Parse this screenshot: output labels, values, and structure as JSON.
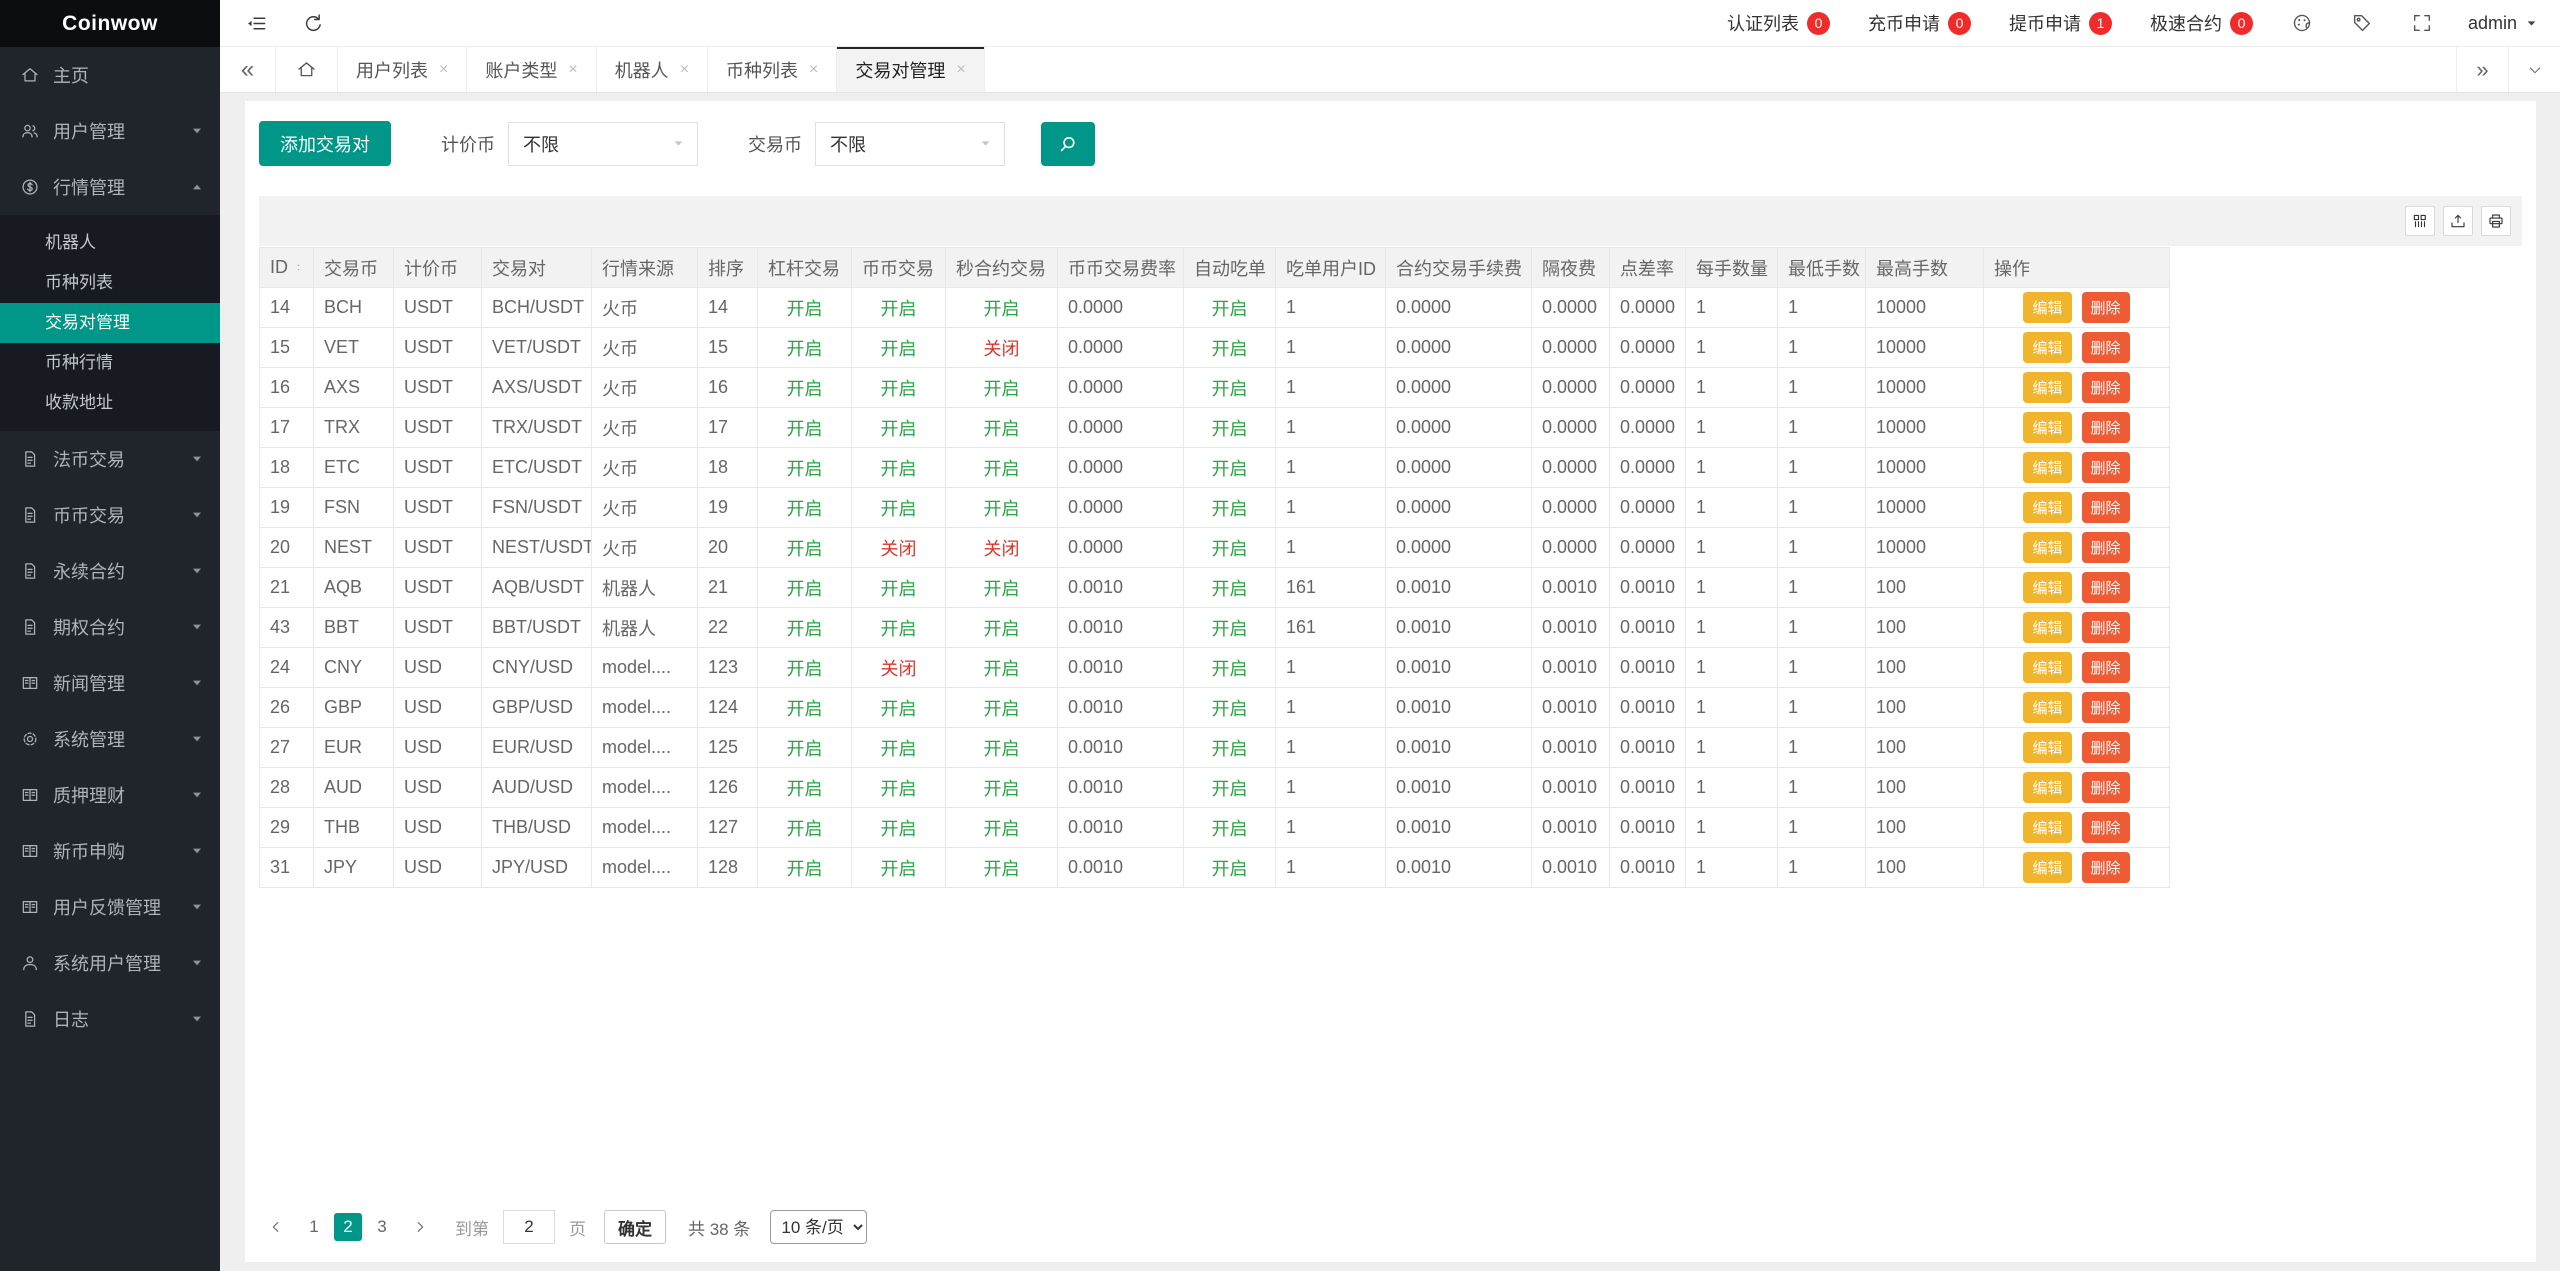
{
  "app": {
    "logo": "Coinwow"
  },
  "sidebar": {
    "items": [
      {
        "name": "home",
        "label": "主页",
        "icon": "home"
      },
      {
        "name": "user-management",
        "label": "用户管理",
        "icon": "users",
        "caret": "down"
      },
      {
        "name": "market-management",
        "label": "行情管理",
        "icon": "market",
        "caret": "up",
        "expanded": true,
        "children": [
          {
            "name": "robots",
            "label": "机器人"
          },
          {
            "name": "coin-list",
            "label": "币种列表"
          },
          {
            "name": "trading-pair-management",
            "label": "交易对管理",
            "active": true
          },
          {
            "name": "coin-market",
            "label": "币种行情"
          },
          {
            "name": "payment-address",
            "label": "收款地址"
          }
        ]
      },
      {
        "name": "fiat-trade",
        "label": "法币交易",
        "icon": "doc",
        "caret": "down"
      },
      {
        "name": "coin-trade",
        "label": "币币交易",
        "icon": "doc",
        "caret": "down"
      },
      {
        "name": "perpetual-contract",
        "label": "永续合约",
        "icon": "doc",
        "caret": "down"
      },
      {
        "name": "options-contract",
        "label": "期权合约",
        "icon": "doc",
        "caret": "down"
      },
      {
        "name": "news-management",
        "label": "新闻管理",
        "icon": "news",
        "caret": "down"
      },
      {
        "name": "system-management",
        "label": "系统管理",
        "icon": "gear",
        "caret": "down"
      },
      {
        "name": "staking-finance",
        "label": "质押理财",
        "icon": "news",
        "caret": "down"
      },
      {
        "name": "new-coin-subscription",
        "label": "新币申购",
        "icon": "news",
        "caret": "down"
      },
      {
        "name": "user-feedback-management",
        "label": "用户反馈管理",
        "icon": "news",
        "caret": "down"
      },
      {
        "name": "system-user-management",
        "label": "系统用户管理",
        "icon": "user",
        "caret": "down"
      },
      {
        "name": "logs",
        "label": "日志",
        "icon": "doc",
        "caret": "down"
      }
    ]
  },
  "topbar": {
    "nav": [
      {
        "name": "auth-list",
        "label": "认证列表",
        "badge": "0"
      },
      {
        "name": "deposit-requests",
        "label": "充币申请",
        "badge": "0"
      },
      {
        "name": "withdraw-requests",
        "label": "提币申请",
        "badge": "1"
      },
      {
        "name": "fast-contract",
        "label": "极速合约",
        "badge": "0"
      }
    ],
    "user": "admin"
  },
  "tabbar": {
    "tabs": [
      {
        "name": "user-list",
        "label": "用户列表"
      },
      {
        "name": "account-type",
        "label": "账户类型"
      },
      {
        "name": "robots",
        "label": "机器人"
      },
      {
        "name": "coin-list",
        "label": "币种列表"
      },
      {
        "name": "trading-pair-management",
        "label": "交易对管理",
        "active": true
      }
    ],
    "close_glyph": "×"
  },
  "filters": {
    "add_button": "添加交易对",
    "quote_label": "计价币",
    "quote_value": "不限",
    "base_label": "交易币",
    "base_value": "不限"
  },
  "table": {
    "columns": [
      "ID",
      "交易币",
      "计价币",
      "交易对",
      "行情来源",
      "排序",
      "杠杆交易",
      "币币交易",
      "秒合约交易",
      "币币交易费率",
      "自动吃单",
      "吃单用户ID",
      "合约交易手续费",
      "隔夜费",
      "点差率",
      "每手数量",
      "最低手数",
      "最高手数",
      "操作"
    ],
    "toggle_on": "开启",
    "toggle_off": "关闭",
    "actions": {
      "edit": "编辑",
      "delete": "删除"
    },
    "rows": [
      [
        "14",
        "BCH",
        "USDT",
        "BCH/USDT",
        "火币",
        "14",
        "开启",
        "开启",
        "开启",
        "0.0000",
        "开启",
        "1",
        "0.0000",
        "0.0000",
        "0.0000",
        "1",
        "1",
        "10000"
      ],
      [
        "15",
        "VET",
        "USDT",
        "VET/USDT",
        "火币",
        "15",
        "开启",
        "开启",
        "关闭",
        "0.0000",
        "开启",
        "1",
        "0.0000",
        "0.0000",
        "0.0000",
        "1",
        "1",
        "10000"
      ],
      [
        "16",
        "AXS",
        "USDT",
        "AXS/USDT",
        "火币",
        "16",
        "开启",
        "开启",
        "开启",
        "0.0000",
        "开启",
        "1",
        "0.0000",
        "0.0000",
        "0.0000",
        "1",
        "1",
        "10000"
      ],
      [
        "17",
        "TRX",
        "USDT",
        "TRX/USDT",
        "火币",
        "17",
        "开启",
        "开启",
        "开启",
        "0.0000",
        "开启",
        "1",
        "0.0000",
        "0.0000",
        "0.0000",
        "1",
        "1",
        "10000"
      ],
      [
        "18",
        "ETC",
        "USDT",
        "ETC/USDT",
        "火币",
        "18",
        "开启",
        "开启",
        "开启",
        "0.0000",
        "开启",
        "1",
        "0.0000",
        "0.0000",
        "0.0000",
        "1",
        "1",
        "10000"
      ],
      [
        "19",
        "FSN",
        "USDT",
        "FSN/USDT",
        "火币",
        "19",
        "开启",
        "开启",
        "开启",
        "0.0000",
        "开启",
        "1",
        "0.0000",
        "0.0000",
        "0.0000",
        "1",
        "1",
        "10000"
      ],
      [
        "20",
        "NEST",
        "USDT",
        "NEST/USDT",
        "火币",
        "20",
        "开启",
        "关闭",
        "关闭",
        "0.0000",
        "开启",
        "1",
        "0.0000",
        "0.0000",
        "0.0000",
        "1",
        "1",
        "10000"
      ],
      [
        "21",
        "AQB",
        "USDT",
        "AQB/USDT",
        "机器人",
        "21",
        "开启",
        "开启",
        "开启",
        "0.0010",
        "开启",
        "161",
        "0.0010",
        "0.0010",
        "0.0010",
        "1",
        "1",
        "100"
      ],
      [
        "43",
        "BBT",
        "USDT",
        "BBT/USDT",
        "机器人",
        "22",
        "开启",
        "开启",
        "开启",
        "0.0010",
        "开启",
        "161",
        "0.0010",
        "0.0010",
        "0.0010",
        "1",
        "1",
        "100"
      ],
      [
        "24",
        "CNY",
        "USD",
        "CNY/USD",
        "model....",
        "123",
        "开启",
        "关闭",
        "开启",
        "0.0010",
        "开启",
        "1",
        "0.0010",
        "0.0010",
        "0.0010",
        "1",
        "1",
        "100"
      ],
      [
        "26",
        "GBP",
        "USD",
        "GBP/USD",
        "model....",
        "124",
        "开启",
        "开启",
        "开启",
        "0.0010",
        "开启",
        "1",
        "0.0010",
        "0.0010",
        "0.0010",
        "1",
        "1",
        "100"
      ],
      [
        "27",
        "EUR",
        "USD",
        "EUR/USD",
        "model....",
        "125",
        "开启",
        "开启",
        "开启",
        "0.0010",
        "开启",
        "1",
        "0.0010",
        "0.0010",
        "0.0010",
        "1",
        "1",
        "100"
      ],
      [
        "28",
        "AUD",
        "USD",
        "AUD/USD",
        "model....",
        "126",
        "开启",
        "开启",
        "开启",
        "0.0010",
        "开启",
        "1",
        "0.0010",
        "0.0010",
        "0.0010",
        "1",
        "1",
        "100"
      ],
      [
        "29",
        "THB",
        "USD",
        "THB/USD",
        "model....",
        "127",
        "开启",
        "开启",
        "开启",
        "0.0010",
        "开启",
        "1",
        "0.0010",
        "0.0010",
        "0.0010",
        "1",
        "1",
        "100"
      ],
      [
        "31",
        "JPY",
        "USD",
        "JPY/USD",
        "model....",
        "128",
        "开启",
        "开启",
        "开启",
        "0.0010",
        "开启",
        "1",
        "0.0010",
        "0.0010",
        "0.0010",
        "1",
        "1",
        "100"
      ]
    ]
  },
  "pagination": {
    "pages": [
      "1",
      "2",
      "3"
    ],
    "current": "2",
    "goto_label": "到第",
    "goto_value": "2",
    "page_word": "页",
    "confirm_label": "确定",
    "total_label": "共 38 条",
    "page_size_label": "10 条/页"
  },
  "colors": {
    "accent_teal": "#009688",
    "badge_red": "#f02b2b",
    "toggle_on_green": "#28a445",
    "toggle_off_red": "#d9342b",
    "edit_button": "#f1b42d",
    "delete_button": "#ee5c36",
    "sidebar_bg": "#20242b"
  }
}
